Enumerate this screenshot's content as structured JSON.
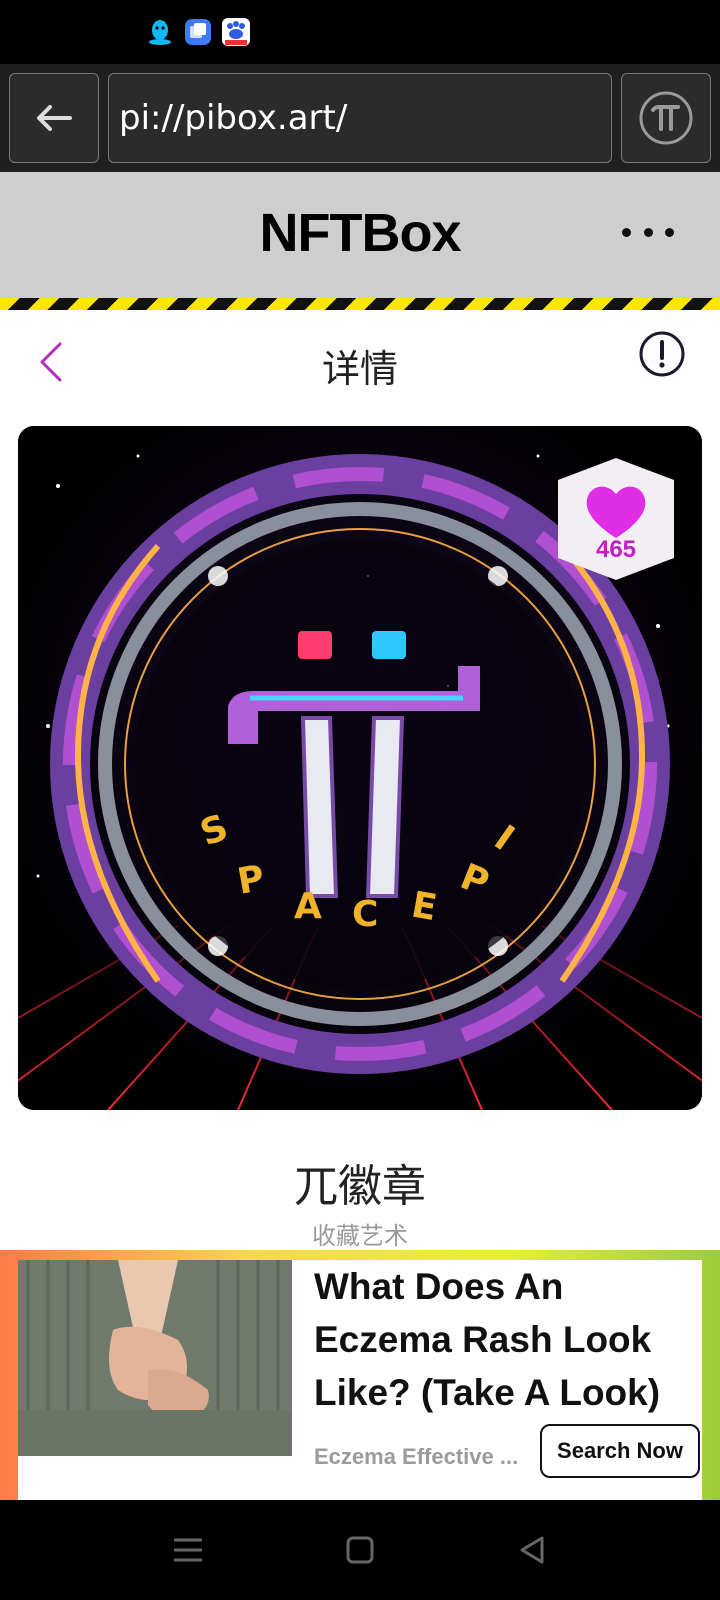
{
  "status_bar": {
    "icons": [
      "qq-icon",
      "multitask-app-icon",
      "baidu-icon"
    ]
  },
  "browser": {
    "url": "pi://pibox.art/",
    "back_icon": "arrow-left-icon",
    "menu_icon": "pi-logo-icon"
  },
  "app_header": {
    "title": "NFTBox",
    "more_icon": "more-dots-icon"
  },
  "page": {
    "title": "详情",
    "back_icon": "chevron-left-icon",
    "info_icon": "exclamation-circle-icon"
  },
  "nft": {
    "artwork": "Pi SPACEPI emblem artwork",
    "likes": "465",
    "title": "兀徽章",
    "subtitle": "收藏艺术"
  },
  "ad": {
    "headline": "What Does An Eczema Rash Look Like? (Take A Look)",
    "source": "Eczema Effective ...",
    "cta": "Search Now"
  },
  "colors": {
    "accent": "#c21fc3",
    "hazard_yellow": "#ffe600",
    "header_bg": "#cecece"
  },
  "system_nav": {
    "menu_icon": "menu-lines-icon",
    "home_icon": "home-square-icon",
    "back_icon": "back-triangle-icon"
  }
}
